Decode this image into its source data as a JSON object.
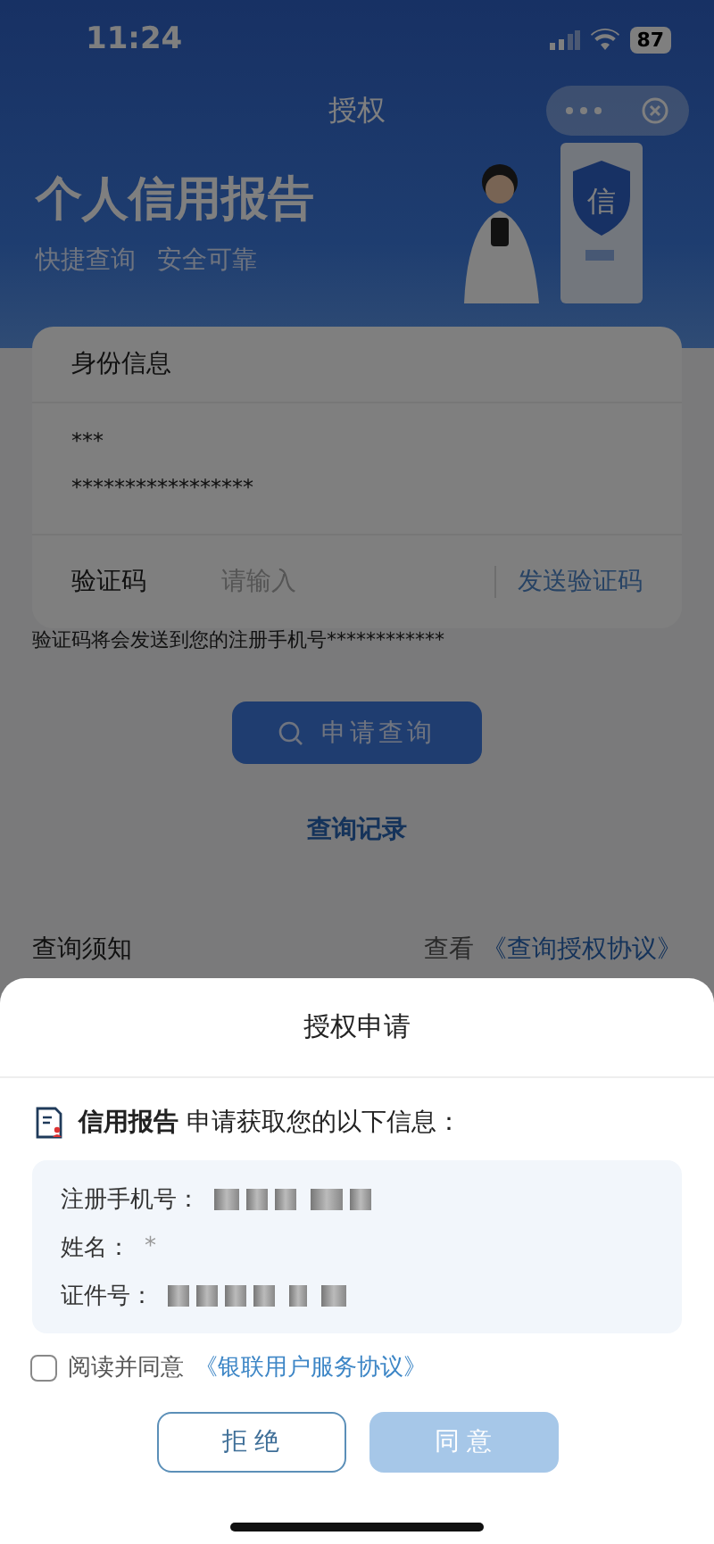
{
  "status_bar": {
    "time": "11:24",
    "battery": "87"
  },
  "nav": {
    "title": "授权"
  },
  "banner": {
    "title": "个人信用报告",
    "tagline_1": "快捷查询",
    "tagline_2": "安全可靠",
    "badge": "信"
  },
  "identity_card": {
    "heading": "身份信息",
    "name": "***",
    "id_number": "*****************",
    "code_label": "验证码",
    "code_placeholder": "请输入",
    "send_code": "发送验证码"
  },
  "hint": "验证码将会发送到您的注册手机号************",
  "query_button": "申请查询",
  "records_link": "查询记录",
  "notice": {
    "title": "查询须知",
    "link_prefix": "查看",
    "link": "《查询授权协议》"
  },
  "sheet": {
    "title": "授权申请",
    "source": "信用报告",
    "request": "申请获取您的以下信息：",
    "fields": [
      {
        "label": "注册手机号："
      },
      {
        "label": "姓名：",
        "value": "*"
      },
      {
        "label": "证件号："
      }
    ],
    "agreement": {
      "checked": false,
      "text": "阅读并同意",
      "link": "《银联用户服务协议》"
    },
    "buttons": [
      {
        "label": "拒 绝",
        "kind": "outline",
        "disabled": false
      },
      {
        "label": "同 意",
        "kind": "primary",
        "disabled": true
      }
    ]
  }
}
